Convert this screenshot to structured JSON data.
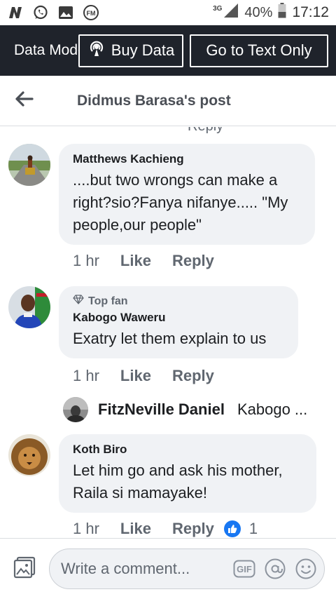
{
  "status_bar": {
    "network": "3G",
    "battery": "40%",
    "time": "17:12",
    "icons": [
      "n-notification-icon",
      "whatsapp-icon",
      "gallery-icon",
      "fm-radio-icon",
      "signal-icon",
      "battery-icon"
    ]
  },
  "data_bar": {
    "label": "Data Mode",
    "buy_data": "Buy Data",
    "text_only": "Go to Text Only"
  },
  "header": {
    "title": "Didmus Barasa's post"
  },
  "cut_reply": "Reply",
  "comments": [
    {
      "name": "Matthews Kachieng",
      "text": "....but two wrongs can make a right?sio?Fanya nifanye..... \"My people,our people\"",
      "time": "1 hr",
      "like": "Like",
      "reply": "Reply"
    },
    {
      "badge": "Top fan",
      "name": "Kabogo Waweru",
      "text": "Exatry let them explain to us",
      "time": "1 hr",
      "like": "Like",
      "reply": "Reply",
      "reply_preview": {
        "name": "FitzNeville Daniel",
        "snippet": "Kabogo ..."
      }
    },
    {
      "name": "Koth Biro",
      "text": "Let him go and ask his mother, Raila si mamayake!",
      "time": "1 hr",
      "like": "Like",
      "reply": "Reply",
      "reactions": "1"
    }
  ],
  "composer": {
    "placeholder": "Write a comment...",
    "gif": "GIF"
  },
  "colors": {
    "accent": "#1877f2",
    "data_bar": "#1f232b",
    "bubble": "#f0f2f5"
  }
}
